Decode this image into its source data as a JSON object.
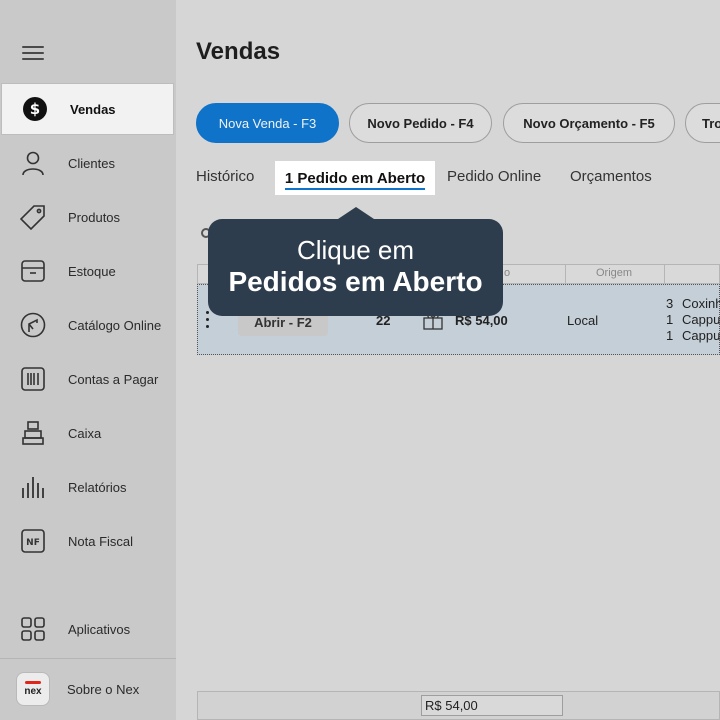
{
  "sidebar": {
    "items": [
      {
        "label": "Vendas",
        "icon": "dollar-icon"
      },
      {
        "label": "Clientes",
        "icon": "user-icon"
      },
      {
        "label": "Produtos",
        "icon": "tag-icon"
      },
      {
        "label": "Estoque",
        "icon": "box-icon"
      },
      {
        "label": "Catálogo Online",
        "icon": "catalog-icon"
      },
      {
        "label": "Contas a Pagar",
        "icon": "barcode-icon"
      },
      {
        "label": "Caixa",
        "icon": "cash-register-icon"
      },
      {
        "label": "Relatórios",
        "icon": "chart-bars-icon"
      },
      {
        "label": "Nota Fiscal",
        "icon": "nf-icon"
      }
    ],
    "apps_label": "Aplicativos",
    "about_label": "Sobre o Nex",
    "logo_text": "nex"
  },
  "header": {
    "title": "Vendas"
  },
  "actions": {
    "new_sale": "Nova Venda - F3",
    "new_order": "Novo Pedido - F4",
    "new_quote": "Novo Orçamento - F5",
    "trade": "Tro"
  },
  "tabs": {
    "history": "Histórico",
    "open_orders": "1 Pedido em Aberto",
    "online_order": "Pedido Online",
    "quotes": "Orçamentos"
  },
  "table": {
    "headers": {
      "col_partial": "o",
      "origin": "Origem"
    },
    "row": {
      "open_button": "Abrir - F2",
      "number": "22",
      "total": "R$ 54,00",
      "origin": "Local",
      "items": [
        {
          "qty": "3",
          "name": "Coxinh"
        },
        {
          "qty": "1",
          "name": "Cappu"
        },
        {
          "qty": "1",
          "name": "Cappu"
        }
      ]
    }
  },
  "footer": {
    "total": "R$ 54,00"
  },
  "tooltip": {
    "line1": "Clique em",
    "line2": "Pedidos em Aberto"
  },
  "colors": {
    "accent": "#0e73c9",
    "tooltip_bg": "#2e3d4d",
    "row_highlight": "#c5cfd8",
    "brand_red": "#e0261b"
  }
}
